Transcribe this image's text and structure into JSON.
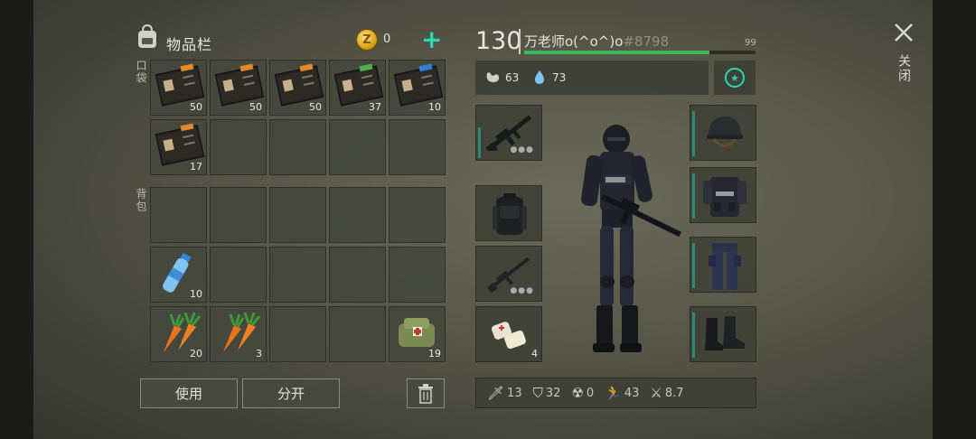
{
  "inventory": {
    "title": "物品栏",
    "coins": "0",
    "add_icon": "+",
    "pocket_label": "口袋",
    "backpack_label": "背包",
    "pocket_items": [
      {
        "name": "notebook-icon",
        "count": "50",
        "accent": "#e08a2a"
      },
      {
        "name": "notebook-icon",
        "count": "50",
        "accent": "#e08a2a"
      },
      {
        "name": "notebook-icon",
        "count": "50",
        "accent": "#e08a2a"
      },
      {
        "name": "green-notebook-icon",
        "count": "37",
        "accent": "#4caf50"
      },
      {
        "name": "blue-notebook-icon",
        "count": "10",
        "accent": "#2f7fd6"
      },
      {
        "name": "notebook-icon",
        "count": "17",
        "accent": "#e08a2a"
      }
    ],
    "backpack_items": [
      {
        "name": "water-bottle-icon",
        "count": "10"
      },
      {
        "name": "carrot-icon",
        "count": "20"
      },
      {
        "name": "carrot-icon",
        "count": "3"
      },
      {
        "name": "medkit-bag-icon",
        "count": "19"
      }
    ],
    "use_label": "使用",
    "split_label": "分开"
  },
  "character": {
    "level": "130",
    "name": "万老师o(^o^)o",
    "tag": "#8798",
    "hp": "99",
    "hp_fraction": 0.8,
    "food": "63",
    "water": "73",
    "bandage_count": "4"
  },
  "stats": [
    {
      "icon": "knife-icon",
      "value": "13"
    },
    {
      "icon": "shield-icon",
      "value": "32"
    },
    {
      "icon": "radiation-icon",
      "value": "0"
    },
    {
      "icon": "running-icon",
      "value": "43"
    },
    {
      "icon": "stealth-icon",
      "value": "8.7"
    }
  ],
  "close_label": "关闭",
  "colors": {
    "accent": "#2fd4b1",
    "hp_bar": "#3db85a",
    "slot_bar": "#2b8a78"
  }
}
